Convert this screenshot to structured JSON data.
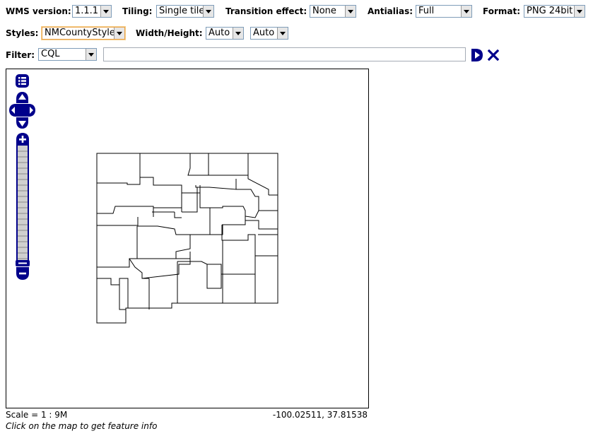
{
  "toolbar": {
    "wms_version": {
      "label": "WMS version:",
      "value": "1.1.1"
    },
    "tiling": {
      "label": "Tiling:",
      "value": "Single tile"
    },
    "transition": {
      "label": "Transition effect:",
      "value": "None"
    },
    "antialias": {
      "label": "Antialias:",
      "value": "Full"
    },
    "format": {
      "label": "Format:",
      "value": "PNG 24bit"
    },
    "styles": {
      "label": "Styles:",
      "value": "NMCountyStyle"
    },
    "size": {
      "label": "Width/Height:",
      "width": "Auto",
      "height": "Auto"
    },
    "filter": {
      "label": "Filter:",
      "language": "CQL",
      "text": ""
    }
  },
  "map": {
    "controls": [
      "layer-switcher-icon",
      "pan-up-icon",
      "pan-left-icon",
      "pan-right-icon",
      "pan-down-icon",
      "zoom-in-icon",
      "zoom-slider",
      "zoom-out-icon"
    ],
    "control_color": "#00008b",
    "feature_stroke": "#000000",
    "region": "New Mexico counties"
  },
  "status": {
    "scale": "Scale = 1 : 9M",
    "coordinates": "-100.02511, 37.81538",
    "hint": "Click on the map to get feature info"
  }
}
